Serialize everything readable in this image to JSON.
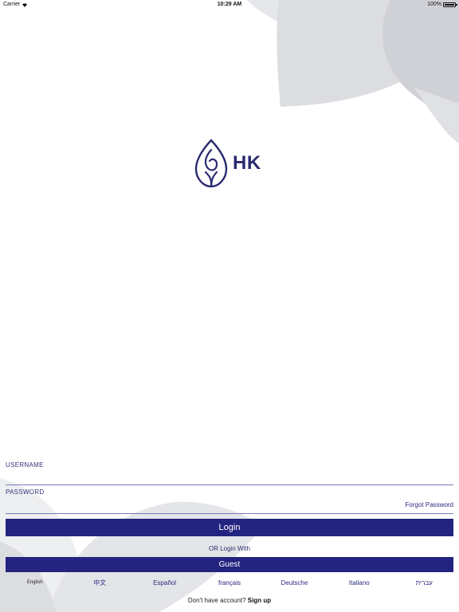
{
  "status_bar": {
    "carrier": "Carrier",
    "time": "10:29 AM",
    "battery": "100%"
  },
  "logo": {
    "text": "HK",
    "icon": "flame-leaf-icon",
    "color": "#2a2a72"
  },
  "form": {
    "username_label": "USERNAME",
    "username_value": "",
    "password_label": "PASSWORD",
    "password_value": "",
    "forgot_password": "Forgot Password",
    "login_label": "Login",
    "or_login_with": "OR Login With",
    "guest_label": "Guest"
  },
  "languages": {
    "items": [
      {
        "label": "English",
        "active": true
      },
      {
        "label": "中文",
        "active": false
      },
      {
        "label": "Español",
        "active": false
      },
      {
        "label": "français",
        "active": false
      },
      {
        "label": "Deutsche",
        "active": false
      },
      {
        "label": "Italiano",
        "active": false
      },
      {
        "label": "עברית",
        "active": false
      }
    ]
  },
  "signup": {
    "prompt": "Don't have account?",
    "link": "Sign up"
  },
  "colors": {
    "primary": "#232380",
    "background": "#ffffff",
    "shape_gray": "#d6d7db"
  }
}
